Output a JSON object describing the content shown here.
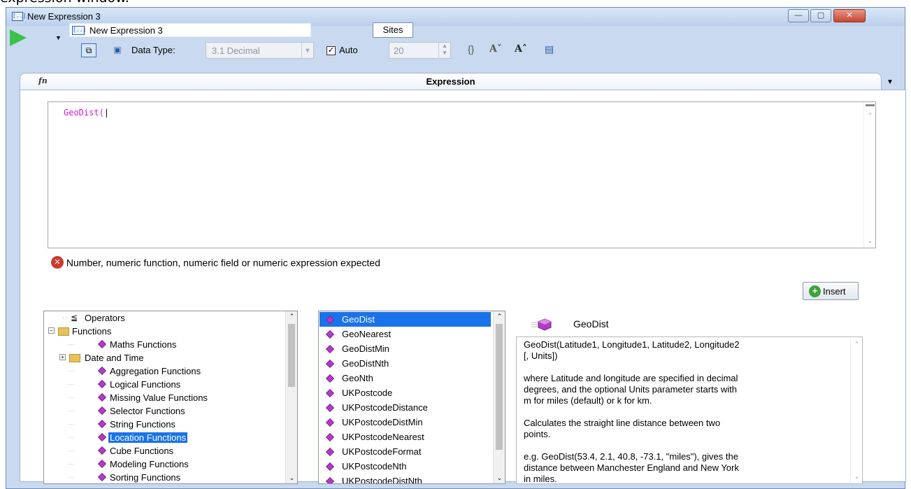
{
  "caption": "expression window.",
  "window": {
    "title": "New Expression 3",
    "icon": "expression-window-icon",
    "controls": {
      "minimize": "—",
      "maximize": "▢",
      "close": "✕"
    }
  },
  "toolbar": {
    "name_value": "New Expression 3",
    "sites_label": "Sites",
    "data_type_label": "Data Type:",
    "data_type_value": "3.1 Decimal",
    "auto_checked": "✓",
    "auto_label": "Auto",
    "precision_value": "20",
    "icons": [
      "run-icon",
      "copy-icon",
      "save-icon",
      "braces-icon",
      "font-decrease-icon",
      "font-increase-icon",
      "palette-icon"
    ]
  },
  "expression_tab": {
    "icon_text": "fn",
    "title": "Expression"
  },
  "editor": {
    "code": "GeoDist(",
    "cursor": "|"
  },
  "error": {
    "icon": "✕",
    "message": "Number, numeric function, numeric field or numeric expression expected"
  },
  "insert_button": {
    "icon": "+",
    "label": "Insert"
  },
  "category_tree": {
    "items": [
      {
        "label": "Operators",
        "level": 0,
        "icon": "operators-icon"
      },
      {
        "label": "Functions",
        "level": 0,
        "icon": "folder-icon",
        "expander": "−"
      },
      {
        "label": "Maths Functions",
        "level": 1,
        "icon": "function-gem-icon"
      },
      {
        "label": "Date and Time",
        "level": 1,
        "icon": "folder-icon",
        "expander": "+"
      },
      {
        "label": "Aggregation Functions",
        "level": 1,
        "icon": "function-gem-icon"
      },
      {
        "label": "Logical Functions",
        "level": 1,
        "icon": "function-gem-icon"
      },
      {
        "label": "Missing Value Functions",
        "level": 1,
        "icon": "function-gem-icon"
      },
      {
        "label": "Selector Functions",
        "level": 1,
        "icon": "function-gem-icon"
      },
      {
        "label": "String Functions",
        "level": 1,
        "icon": "function-gem-icon"
      },
      {
        "label": "Location Functions",
        "level": 1,
        "icon": "function-gem-icon",
        "selected": true
      },
      {
        "label": "Cube Functions",
        "level": 1,
        "icon": "function-gem-icon"
      },
      {
        "label": "Modeling Functions",
        "level": 1,
        "icon": "function-gem-icon"
      },
      {
        "label": "Sorting Functions",
        "level": 1,
        "icon": "function-gem-icon"
      }
    ]
  },
  "function_list": {
    "items": [
      {
        "label": "GeoDist",
        "selected": true
      },
      {
        "label": "GeoNearest"
      },
      {
        "label": "GeoDistMin"
      },
      {
        "label": "GeoDistNth"
      },
      {
        "label": "GeoNth"
      },
      {
        "label": "UKPostcode"
      },
      {
        "label": "UKPostcodeDistance"
      },
      {
        "label": "UKPostcodeDistMin"
      },
      {
        "label": "UKPostcodeNearest"
      },
      {
        "label": "UKPostcodeFormat"
      },
      {
        "label": "UKPostcodeNth"
      },
      {
        "label": "UKPostcodeDistNth"
      }
    ]
  },
  "help": {
    "title": "GeoDist",
    "text": "GeoDist(Latitude1, Longitude1, Latitude2, Longitude2\n[, Units])\n\nwhere Latitude and longitude are specified in decimal\ndegrees, and the optional Units parameter starts with\nm for miles (default) or k for km.\n\nCalculates the straight line distance between two\npoints.\n\ne.g. GeoDist(53.4, 2.1, 40.8, -73.1, \"miles\"), gives the\ndistance between Manchester England and New York\nin miles."
  },
  "colors": {
    "selection": "#1a73e8",
    "function_text": "#d21ad2",
    "error": "#cc3b2f",
    "run": "#3bc34a"
  }
}
